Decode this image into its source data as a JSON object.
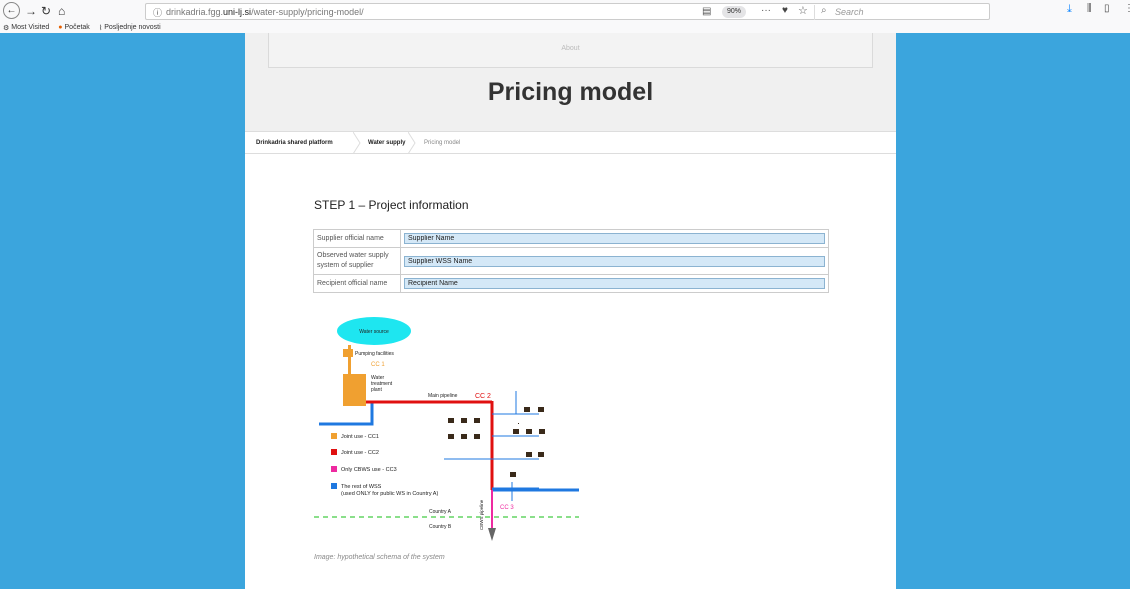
{
  "browser": {
    "url_host": "drinkadria.fgg.",
    "url_domain": "uni-lj.si",
    "url_path": "/water-supply/pricing-model/",
    "zoom": "90%",
    "search_placeholder": "Search",
    "bookmarks": [
      {
        "label": "Most Visited"
      },
      {
        "label": "Početak"
      },
      {
        "label": "Posljednje novosti"
      }
    ]
  },
  "page": {
    "hero_box_text": "About",
    "title": "Pricing model",
    "breadcrumbs": [
      "Drinkadria shared platform",
      "Water supply",
      "Pricing model"
    ],
    "section_title": "STEP 1 – Project information",
    "table": {
      "rows": [
        {
          "label": "Supplier official name",
          "value": "Supplier Name"
        },
        {
          "label": "Observed water supply system of supplier",
          "value": "Supplier WSS Name"
        },
        {
          "label": "Recipient official name",
          "value": "Recipient Name"
        }
      ]
    },
    "diagram": {
      "water_source": "Water source",
      "pumping": "Pumping facilities",
      "cc1": "CC 1",
      "plant_l1": "Water",
      "plant_l2": "treatment",
      "plant_l3": "plant",
      "main_pipeline": "Main pipeline",
      "cc2": "CC 2",
      "cc3": "CC 3",
      "cbws": "CBWS pipeline",
      "country_a": "Country A",
      "country_b": "Country B",
      "legend": [
        {
          "label": "Joint use - CC1",
          "color": "#f0a030"
        },
        {
          "label": "Joint use - CC2",
          "color": "#e01010"
        },
        {
          "label": "Only CBWS use - CC3",
          "color": "#ee2aa0"
        },
        {
          "label": "The rest of WSS",
          "color": "#1f78e0"
        }
      ],
      "legend_sub": "(used ONLY for public WS in Country A)"
    },
    "caption": "Image: hypothetical schema of the system"
  }
}
